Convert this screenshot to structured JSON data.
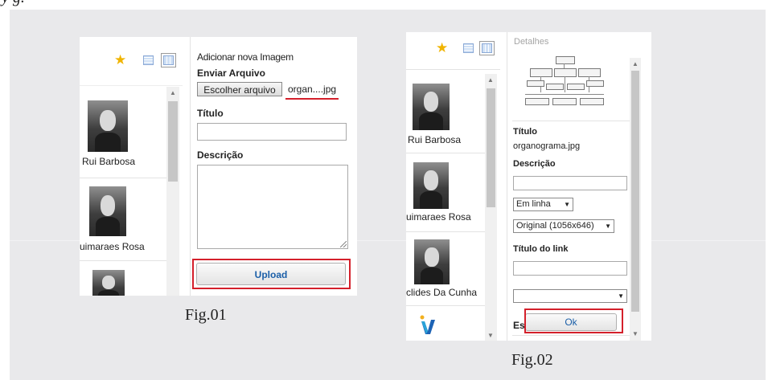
{
  "page": {
    "top_fragment": "y g."
  },
  "fig1": {
    "caption": "Fig.01",
    "toolbar": {
      "favorite_icon": "star-icon",
      "list_view_icon": "list-view-icon",
      "grid_view_icon": "grid-view-icon"
    },
    "people": [
      {
        "name": "Rui Barbosa"
      },
      {
        "name": "uimaraes Rosa"
      }
    ],
    "form": {
      "heading": "Adicionar nova Imagem",
      "upload_label": "Enviar Arquivo",
      "choose_file_button": "Escolher arquivo",
      "file_name": "organ....jpg",
      "title_label": "Título",
      "title_value": "",
      "description_label": "Descrição",
      "description_value": "",
      "upload_button": "Upload"
    }
  },
  "fig2": {
    "caption": "Fig.02",
    "people": [
      {
        "name": "Rui Barbosa"
      },
      {
        "name": "uimaraes Rosa"
      },
      {
        "name": "clides Da Cunha"
      }
    ],
    "details": {
      "heading": "Detalhes",
      "title_label": "Título",
      "title_value": "organograma.jpg",
      "description_label": "Descrição",
      "description_value": "",
      "alignment_select": "Em linha",
      "size_select": "Original (1056x646)",
      "link_title_label": "Título do link",
      "link_title_value": "",
      "link_select": "",
      "partial_label": "Es",
      "ok_button": "Ok"
    }
  },
  "colors": {
    "highlight_red": "#d4202b",
    "link_blue": "#1b5fa8",
    "panel_bg": "#e9e9eb"
  }
}
